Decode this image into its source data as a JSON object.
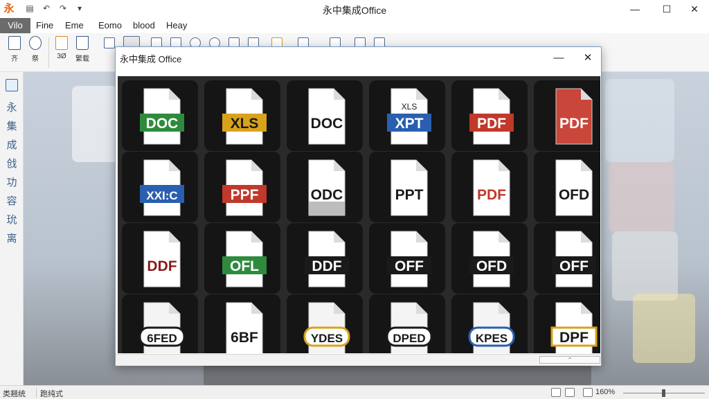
{
  "titlebar": {
    "title": "永中集成Office",
    "app_icon_glyph": "永",
    "minimize_glyph": "—",
    "maximize_glyph": "☐",
    "close_glyph": "✕"
  },
  "menu": [
    "Vilo",
    "Fine",
    "Eme",
    "Eomo",
    "blood",
    "Heay"
  ],
  "ribbon": {
    "labels": [
      "齐",
      "祭",
      "3Ø",
      "繁载"
    ]
  },
  "leftbar": {
    "chars": [
      "永",
      "集",
      "成",
      "戗",
      "功",
      "容",
      "玧",
      "离"
    ]
  },
  "dialog": {
    "title": "永中集成 Office",
    "close_glyph": "✕",
    "minimize_glyph": "—",
    "scroll_glyph": "⌃",
    "tiles": [
      {
        "label": "DOC",
        "sub": "",
        "style": "green-band"
      },
      {
        "label": "XLS",
        "sub": "",
        "style": "yellow-band"
      },
      {
        "label": "DOC",
        "sub": "",
        "style": "plain-dark"
      },
      {
        "label": "XPT",
        "sub": "XLS",
        "style": "blue-band"
      },
      {
        "label": "PDF",
        "sub": "",
        "style": "red-band"
      },
      {
        "label": "PDF",
        "sub": "",
        "style": "red-full"
      },
      {
        "label": "XXI:C",
        "sub": "",
        "style": "blue-band"
      },
      {
        "label": "PPF",
        "sub": "",
        "style": "red-ribbon"
      },
      {
        "label": "ODC",
        "sub": "",
        "style": "grey-base"
      },
      {
        "label": "PPT",
        "sub": "",
        "style": "plain-dark"
      },
      {
        "label": "PDF",
        "sub": "",
        "style": "red-text"
      },
      {
        "label": "OFD",
        "sub": "",
        "style": "plain-dark"
      },
      {
        "label": "DDF",
        "sub": "",
        "style": "red-text-dark"
      },
      {
        "label": "OFL",
        "sub": "",
        "style": "green-band"
      },
      {
        "label": "DDF",
        "sub": "",
        "style": "dark-band"
      },
      {
        "label": "OFF",
        "sub": "",
        "style": "dark-band"
      },
      {
        "label": "OFD",
        "sub": "",
        "style": "dark-band"
      },
      {
        "label": "OFF",
        "sub": "",
        "style": "dark-band"
      },
      {
        "label": "6FED",
        "sub": "",
        "style": "outline"
      },
      {
        "label": "6BF",
        "sub": "",
        "style": "plain-dark"
      },
      {
        "label": "YDES",
        "sub": "",
        "style": "gold-outline"
      },
      {
        "label": "DPED",
        "sub": "",
        "style": "outline"
      },
      {
        "label": "KPES",
        "sub": "",
        "style": "blue-outline"
      },
      {
        "label": "DPF",
        "sub": "",
        "style": "gold-band"
      }
    ]
  },
  "status": {
    "left1": "类翘统",
    "left2": "跑纯式",
    "zoom": "160%"
  },
  "colors": {
    "accent": "#e8630a",
    "menu_active_bg": "#6b6b6b",
    "dialog_border": "#7a9cc6",
    "green": "#2e8b3d",
    "blue": "#2a5fb0",
    "red": "#c0392b",
    "gold": "#d9a21b"
  }
}
